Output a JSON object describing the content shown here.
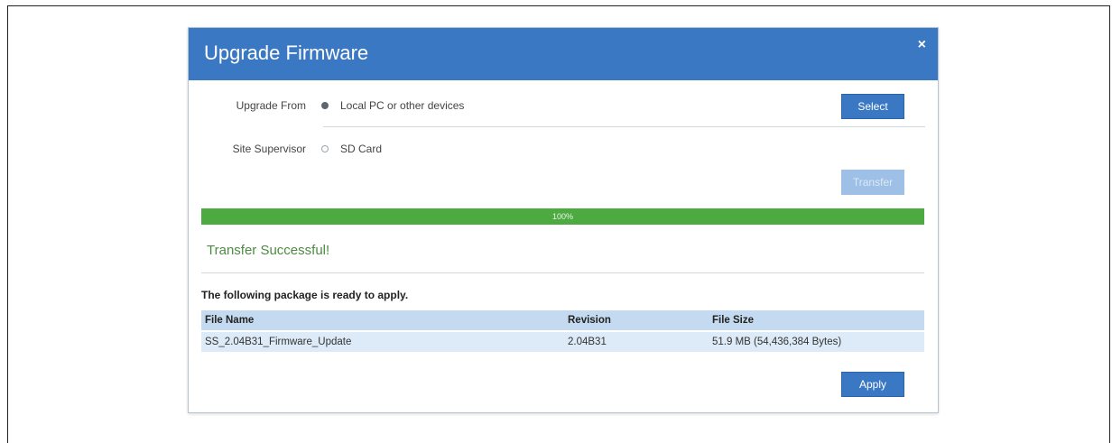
{
  "dialog": {
    "title": "Upgrade Firmware",
    "close_symbol": "×",
    "close_icon": "close-icon"
  },
  "upgrade": {
    "from_label": "Upgrade From",
    "option_local": "Local PC or other devices",
    "option_local_checked": true,
    "site_label": "Site Supervisor",
    "option_sd": "SD Card",
    "option_sd_checked": false,
    "select_button": "Select",
    "transfer_button": "Transfer"
  },
  "progress": {
    "value_percent": 100,
    "label": "100%"
  },
  "status": {
    "message": "Transfer Successful!",
    "ready_text": "The following package is ready to apply."
  },
  "table": {
    "headers": [
      "File Name",
      "Revision",
      "File Size"
    ],
    "rows": [
      [
        "SS_2.04B31_Firmware_Update",
        "2.04B31",
        "51.9 MB (54,436,384 Bytes)"
      ]
    ]
  },
  "apply_button": "Apply",
  "colors": {
    "header_blue": "#3a78c4",
    "progress_green": "#4caa41",
    "success_green": "#4e8a43",
    "table_header": "#c4daf0",
    "table_row": "#ddeaf7"
  }
}
